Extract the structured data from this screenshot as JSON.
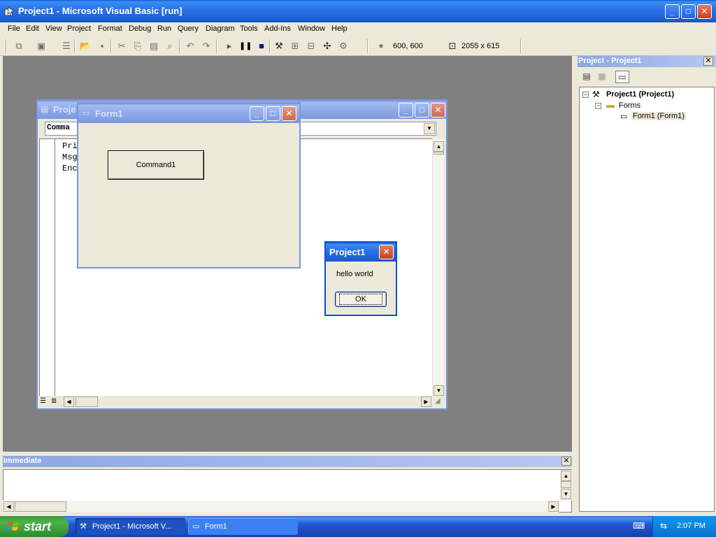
{
  "main_window": {
    "title": "Project1 - Microsoft Visual Basic [run]"
  },
  "menu": [
    "File",
    "Edit",
    "View",
    "Project",
    "Format",
    "Debug",
    "Run",
    "Query",
    "Diagram",
    "Tools",
    "Add-Ins",
    "Window",
    "Help"
  ],
  "toolbar": {
    "position_readout": "600, 600",
    "size_readout": "2055 x 615"
  },
  "code_window": {
    "title": "Proje",
    "object_combo": "Comma",
    "lines": [
      "Pri",
      "Msg",
      "Enc"
    ]
  },
  "form1": {
    "title": "Form1",
    "button_label": "Command1"
  },
  "msgbox": {
    "title": "Project1",
    "text": "hello world",
    "ok_label": "OK"
  },
  "project_explorer": {
    "title": "Project - Project1",
    "tree": {
      "root": "Project1 (Project1)",
      "folder": "Forms",
      "item": "Form1 (Form1)"
    }
  },
  "immediate": {
    "title": "Immediate"
  },
  "taskbar": {
    "start_label": "start",
    "tasks": [
      "Project1 - Microsoft V...",
      "Form1"
    ],
    "clock": "2:07 PM"
  }
}
